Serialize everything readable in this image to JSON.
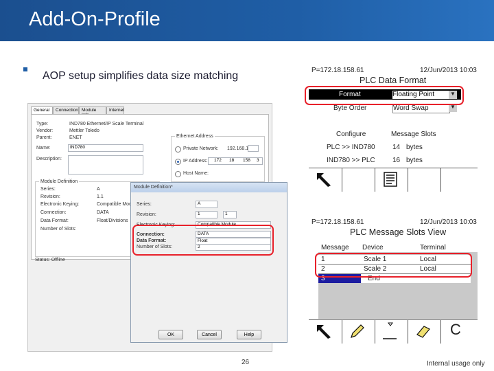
{
  "slide": {
    "title": "Add-On-Profile",
    "bullet": "AOP setup simplifies data size matching",
    "page_number": "26",
    "footer": "Internal usage only"
  },
  "general_dialog": {
    "tabs": [
      "General",
      "Connection",
      "Module Info",
      "Internet"
    ],
    "type_label": "Type:",
    "type_value": "IND780 Ethernet/IP Scale Terminal",
    "vendor_label": "Vendor:",
    "vendor_value": "Mettler Toledo",
    "parent_label": "Parent:",
    "parent_value": "ENET",
    "name_label": "Name:",
    "name_value": "IND780",
    "description_label": "Description:",
    "ethernet_address_label": "Ethernet Address",
    "private_network_label": "Private Network:",
    "private_network_value": "192.168.1.",
    "ip_address_label": "IP Address:",
    "ip_octets": [
      "172",
      "18",
      "158",
      "3"
    ],
    "host_name_label": "Host Name:",
    "module_definition_label": "Module Definition",
    "series_label": "Series:",
    "series_value": "A",
    "revision_label": "Revision:",
    "revision_value": "1.1",
    "keying_label": "Electronic Keying:",
    "keying_value": "Compatible Module",
    "connection_label": "Connection:",
    "connection_value": "DATA",
    "data_format_label": "Data Format:",
    "data_format_value": "Float/Divisions",
    "slots_label": "Number of Slots:",
    "status_label": "Status: Offline"
  },
  "module_definition": {
    "title": "Module Definition*",
    "series_label": "Series:",
    "series_value": "A",
    "revision_label": "Revision:",
    "revision_value": "1",
    "revision_minor": "1",
    "keying_label": "Electronic Keying:",
    "keying_value": "Compatible Module",
    "connection_label": "Connection:",
    "connection_value": "DATA",
    "data_format_label": "Data Format:",
    "data_format_value": "Float",
    "slots_label": "Number of Slots:",
    "slots_value": "2",
    "ok_label": "OK",
    "cancel_label": "Cancel",
    "help_label": "Help"
  },
  "terminal_format": {
    "ip": "P=172.18.158.61",
    "date": "12/Jun/2013 10:03",
    "heading": "PLC Data Format",
    "format_label": "Format",
    "format_value": "Floating Point",
    "byte_order_label": "Byte Order",
    "byte_order_value": "Word Swap",
    "col_configure": "Configure",
    "col_slots": "Message Slots",
    "row1_label": "PLC >> IND780",
    "row1_value": "14",
    "row1_unit": "bytes",
    "row2_label": "IND780 >> PLC",
    "row2_value": "16",
    "row2_unit": "bytes"
  },
  "terminal_slots": {
    "ip": "P=172.18.158.61",
    "date": "12/Jun/2013 10:03",
    "heading": "PLC Message Slots View",
    "col_message": "Message",
    "col_device": "Device",
    "col_terminal": "Terminal",
    "rows": [
      {
        "message": "1",
        "device": "Scale 1",
        "terminal": "Local"
      },
      {
        "message": "2",
        "device": "Scale 2",
        "terminal": "Local"
      },
      {
        "message": "3",
        "device": "End",
        "terminal": ""
      }
    ],
    "soft_key_c": "C"
  },
  "colors": {
    "title_bar": "#1f5ea6",
    "highlight": "#e8202a",
    "selection": "#1c1ca0"
  },
  "icons": [
    "back-arrow-icon",
    "list-view-icon",
    "edit-pencil-icon",
    "insert-icon",
    "eraser-icon"
  ]
}
